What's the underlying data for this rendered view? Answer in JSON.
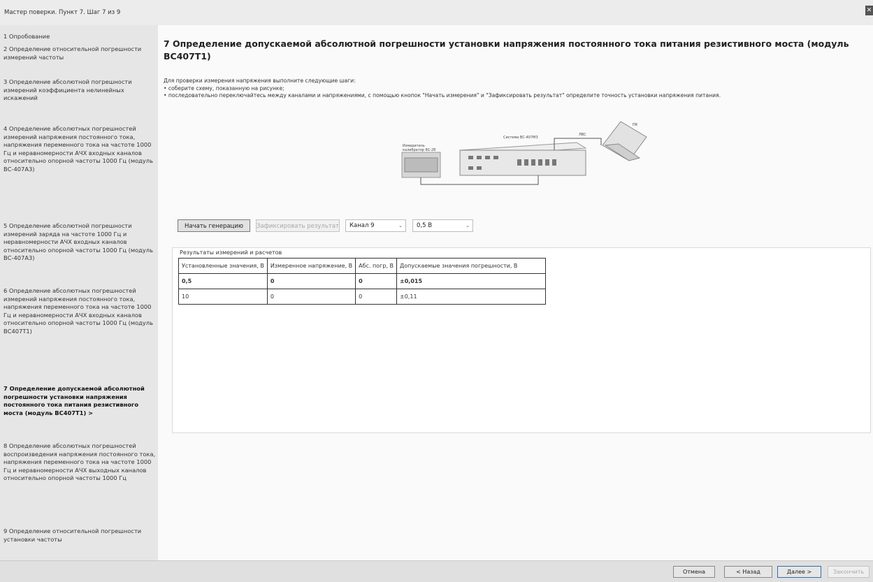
{
  "window": {
    "title": "Мастер поверки. Пункт 7. Шаг 7 из 9",
    "close_glyph": "✕"
  },
  "sidebar": {
    "steps": [
      "1 Опробование",
      "2 Определение относительной погрешности измерений частоты",
      "3 Определение абсолютной погрешности измерений коэффициента нелинейных искажений",
      "4 Определение абсолютных погрешностей измерений напряжения постоянного тока, напряжения переменного тока на частоте 1000 Гц и неравномерности АЧХ входных каналов относительно опорной частоты 1000 Гц (модуль ВС-407А3)",
      "5 Определение абсолютной погрешности измерений заряда на частоте 1000 Гц и неравномерности АЧХ входных каналов относительно опорной частоты 1000 Гц (модуль ВС-407А3)",
      "6 Определение абсолютных погрешностей измерений напряжения постоянного тока, напряжения переменного тока на частоте 1000 Гц и неравномерности АЧХ входных каналов относительно опорной частоты 1000 Гц (модуль ВС407Т1)",
      "7 Определение допускаемой абсолютной погрешности установки напряжения постоянного тока питания резистивного моста (модуль ВС407Т1) >",
      "8 Определение абсолютных погрешностей воспроизведения напряжения постоянного тока, напряжения переменного тока на частоте 1000 Гц и неравномерности АЧХ выходных каналов относительно опорной частоты 1000 Гц",
      "9 Определение относительной погрешности установки частоты"
    ]
  },
  "main": {
    "heading": "7 Определение допускаемой абсолютной погрешности установки напряжения постоянного тока питания резистивного моста (модуль ВС407Т1)",
    "intro": "Для проверки измерения напряжения выполните следующие шаги:",
    "bullets": [
      "• соберите схему, показанную на рисунке;",
      "• последовательно переключайтесь между каналами и напряжениями, с помощью кнопок \"Начать измерения\" и \"Зафиксировать результат\" определите точность установки напряжения питания."
    ],
    "diagram": {
      "label_meter": "Измеритель",
      "label_meter2": "калибратор В1-28",
      "label_system": "Система ВС-407М3",
      "label_cable": "ЛВС",
      "label_pc": "ПК"
    },
    "controls": {
      "start_label": "Начать генерацию",
      "fix_label": "Зафиксировать результат",
      "channel_value": "Канал 9",
      "voltage_value": "0,5 В",
      "arrow": "⌄"
    },
    "results": {
      "title": "Результаты измерений и расчетов",
      "headers": [
        "Установленные значения, В",
        "Измеренное напряжение, В",
        "Абс. погр, В",
        "Допускаемые значения погрешности, В"
      ],
      "rows": [
        [
          "0,5",
          "0",
          "0",
          "±0,015"
        ],
        [
          "10",
          "0",
          "0",
          "±0,11"
        ]
      ]
    }
  },
  "footer": {
    "cancel_label": "Отмена",
    "back_label": "< Назад",
    "next_label": "Далее >",
    "finish_label": "Закончить"
  }
}
